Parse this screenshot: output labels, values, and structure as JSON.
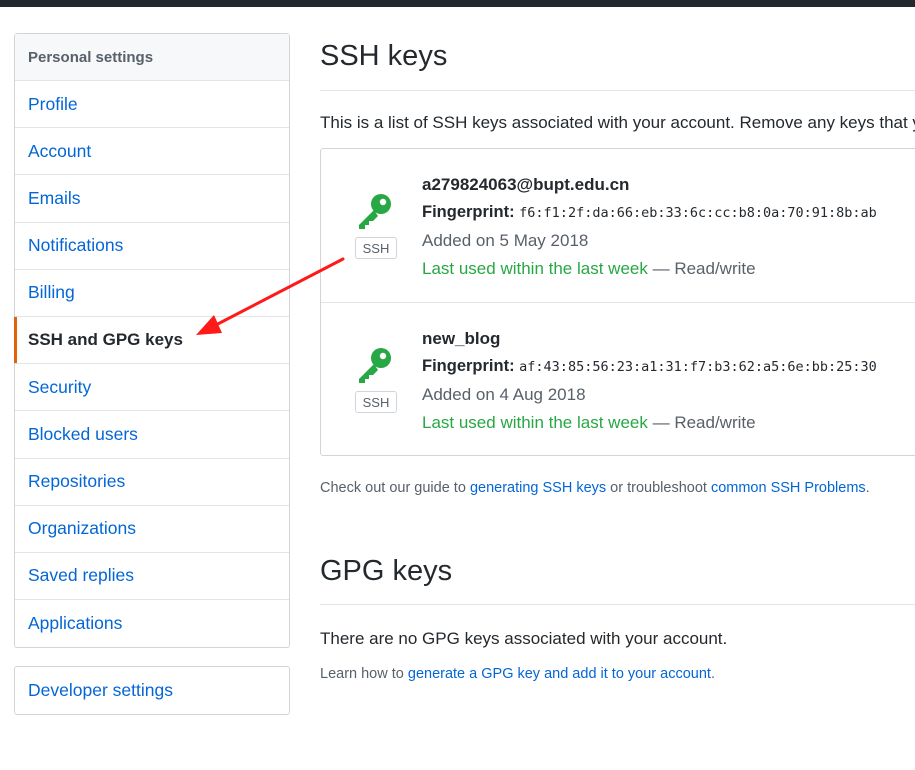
{
  "sidebar": {
    "heading": "Personal settings",
    "items": [
      {
        "label": "Profile"
      },
      {
        "label": "Account"
      },
      {
        "label": "Emails"
      },
      {
        "label": "Notifications"
      },
      {
        "label": "Billing"
      },
      {
        "label": "SSH and GPG keys"
      },
      {
        "label": "Security"
      },
      {
        "label": "Blocked users"
      },
      {
        "label": "Repositories"
      },
      {
        "label": "Organizations"
      },
      {
        "label": "Saved replies"
      },
      {
        "label": "Applications"
      }
    ],
    "developer_settings": "Developer settings"
  },
  "ssh": {
    "title": "SSH keys",
    "description": "This is a list of SSH keys associated with your account. Remove any keys that y",
    "keys": [
      {
        "title": "a279824063@bupt.edu.cn",
        "fingerprint_label": "Fingerprint:",
        "fingerprint": "f6:f1:2f:da:66:eb:33:6c:cc:b8:0a:70:91:8b:ab",
        "added": "Added on 5 May 2018",
        "last_used": "Last used within the last week",
        "access": "— Read/write",
        "badge": "SSH"
      },
      {
        "title": "new_blog",
        "fingerprint_label": "Fingerprint:",
        "fingerprint": "af:43:85:56:23:a1:31:f7:b3:62:a5:6e:bb:25:30",
        "added": "Added on 4 Aug 2018",
        "last_used": "Last used within the last week",
        "access": "— Read/write",
        "badge": "SSH"
      }
    ],
    "guide_prefix": "Check out our guide to ",
    "guide_link": "generating SSH keys",
    "guide_middle": " or troubleshoot ",
    "guide_link2": "common SSH Problems",
    "guide_suffix": "."
  },
  "gpg": {
    "title": "GPG keys",
    "empty": "There are no GPG keys associated with your account.",
    "learn_prefix": "Learn how to ",
    "learn_link": "generate a GPG key and add it to your account",
    "learn_suffix": "."
  },
  "colors": {
    "accent": "#0366d6",
    "selected_border": "#e36209",
    "key_green": "#28a745",
    "annotation_arrow": "#ff1a1a"
  }
}
